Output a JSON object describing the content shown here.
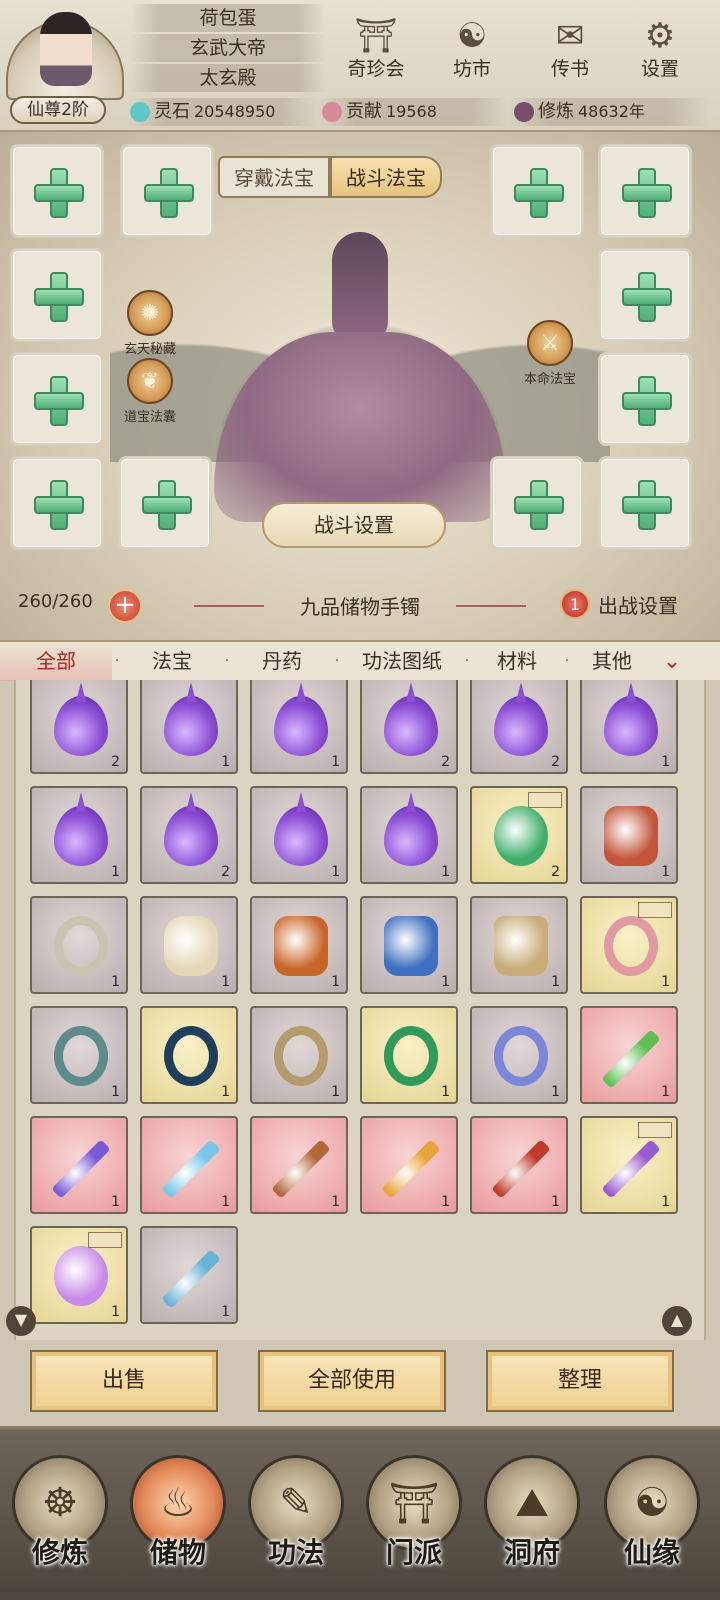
{
  "header": {
    "rank": "仙尊2阶",
    "titles": [
      "荷包蛋",
      "玄武大帝",
      "太玄殿"
    ],
    "buttons": [
      {
        "label": "奇珍会",
        "icon": "treasure-pavilion-icon"
      },
      {
        "label": "坊市",
        "icon": "market-icon"
      },
      {
        "label": "传书",
        "icon": "scroll-letter-icon"
      },
      {
        "label": "设置",
        "icon": "gear-icon"
      }
    ],
    "resources": [
      {
        "label": "灵石",
        "value": "20548950",
        "icon": "spirit-stone-icon",
        "color": "#5fc6c9"
      },
      {
        "label": "贡献",
        "value": "19568",
        "icon": "contribution-icon",
        "color": "#d98a9a"
      },
      {
        "label": "修炼",
        "value": "48632年",
        "icon": "cultivation-icon",
        "color": "#7a4f6a"
      }
    ]
  },
  "equip": {
    "tabs": [
      "穿戴法宝",
      "战斗法宝"
    ],
    "active_tab": "战斗法宝",
    "side_icons": [
      {
        "label": "玄天秘藏",
        "icon": "mystic-vault-icon"
      },
      {
        "label": "道宝法囊",
        "icon": "treasure-pouch-icon"
      },
      {
        "label": "本命法宝",
        "icon": "life-treasure-icon"
      }
    ],
    "battle_settings": "战斗设置",
    "capacity": "260/260",
    "bag_name": "九品储物手镯",
    "deploy_count": "1",
    "deploy_label": "出战设置"
  },
  "categories": [
    "全部",
    "法宝",
    "丹药",
    "功法图纸",
    "材料",
    "其他"
  ],
  "active_category": "全部",
  "inventory": [
    {
      "kind": "drop",
      "bg": "purple",
      "qty": "2",
      "color": "#8b4ed4"
    },
    {
      "kind": "drop",
      "bg": "purple",
      "qty": "1",
      "color": "#8b4ed4"
    },
    {
      "kind": "drop",
      "bg": "purple",
      "qty": "1",
      "color": "#8b4ed4"
    },
    {
      "kind": "drop",
      "bg": "purple",
      "qty": "2",
      "color": "#8b4ed4"
    },
    {
      "kind": "drop",
      "bg": "purple",
      "qty": "2",
      "color": "#8b4ed4"
    },
    {
      "kind": "drop",
      "bg": "purple",
      "qty": "1",
      "color": "#8b4ed4"
    },
    {
      "kind": "drop",
      "bg": "purple",
      "qty": "1",
      "color": "#8b4ed4"
    },
    {
      "kind": "drop",
      "bg": "purple",
      "qty": "2",
      "color": "#8b4ed4"
    },
    {
      "kind": "drop",
      "bg": "purple",
      "qty": "1",
      "color": "#8b4ed4"
    },
    {
      "kind": "drop",
      "bg": "purple",
      "qty": "1",
      "color": "#8b4ed4"
    },
    {
      "kind": "orb",
      "bg": "gold",
      "qty": "2",
      "lock": true,
      "color": "#3fae6b"
    },
    {
      "kind": "armor",
      "bg": "purple",
      "qty": "1",
      "color": "#c2553a"
    },
    {
      "kind": "ring",
      "bg": "purple",
      "qty": "1",
      "color": "#c9c3b0"
    },
    {
      "kind": "fist",
      "bg": "purple",
      "qty": "1",
      "color": "#e4d8b6"
    },
    {
      "kind": "armor",
      "bg": "purple",
      "qty": "1",
      "color": "#c8662a"
    },
    {
      "kind": "armor",
      "bg": "purple",
      "qty": "1",
      "color": "#3e6fc0"
    },
    {
      "kind": "boot",
      "bg": "purple",
      "qty": "1",
      "color": "#c9ac78"
    },
    {
      "kind": "ring",
      "bg": "gold",
      "qty": "1",
      "lock": true,
      "color": "#e29aa2"
    },
    {
      "kind": "ring",
      "bg": "purple",
      "qty": "1",
      "color": "#5d8a8a"
    },
    {
      "kind": "ring",
      "bg": "gold",
      "qty": "1",
      "color": "#1f3f5a"
    },
    {
      "kind": "ring",
      "bg": "purple",
      "qty": "1",
      "color": "#b59a6e"
    },
    {
      "kind": "ring",
      "bg": "gold",
      "qty": "1",
      "color": "#2f9a5a"
    },
    {
      "kind": "ring",
      "bg": "purple",
      "qty": "1",
      "color": "#7a86d8"
    },
    {
      "kind": "sword",
      "bg": "red",
      "qty": "1",
      "color": "#5fbf55"
    },
    {
      "kind": "sword",
      "bg": "red",
      "qty": "1",
      "color": "#7a5ad8"
    },
    {
      "kind": "sword",
      "bg": "red",
      "qty": "1",
      "color": "#7ac6e8"
    },
    {
      "kind": "sword",
      "bg": "red",
      "qty": "1",
      "color": "#b0683a"
    },
    {
      "kind": "sword",
      "bg": "red",
      "qty": "1",
      "color": "#e8a43a"
    },
    {
      "kind": "sword",
      "bg": "red",
      "qty": "1",
      "color": "#c23a2a"
    },
    {
      "kind": "sword",
      "bg": "gold",
      "qty": "1",
      "lock": true,
      "color": "#9a5ad0"
    },
    {
      "kind": "orb",
      "bg": "gold",
      "qty": "1",
      "lock": true,
      "color": "#c88ae8"
    },
    {
      "kind": "sword",
      "bg": "purple",
      "qty": "1",
      "color": "#6ab2d8"
    }
  ],
  "actions": [
    "出售",
    "全部使用",
    "整理"
  ],
  "nav": [
    {
      "label": "修炼",
      "icon": "cultivate-icon",
      "active": false
    },
    {
      "label": "储物",
      "icon": "storage-bag-icon",
      "active": true
    },
    {
      "label": "功法",
      "icon": "technique-scroll-icon",
      "active": false
    },
    {
      "label": "门派",
      "icon": "sect-gate-icon",
      "active": false
    },
    {
      "label": "洞府",
      "icon": "cave-abode-icon",
      "active": false
    },
    {
      "label": "仙缘",
      "icon": "immortal-fate-icon",
      "active": false
    }
  ],
  "colors": {
    "accent": "#b0271b",
    "plus_green": "#4fae77"
  }
}
